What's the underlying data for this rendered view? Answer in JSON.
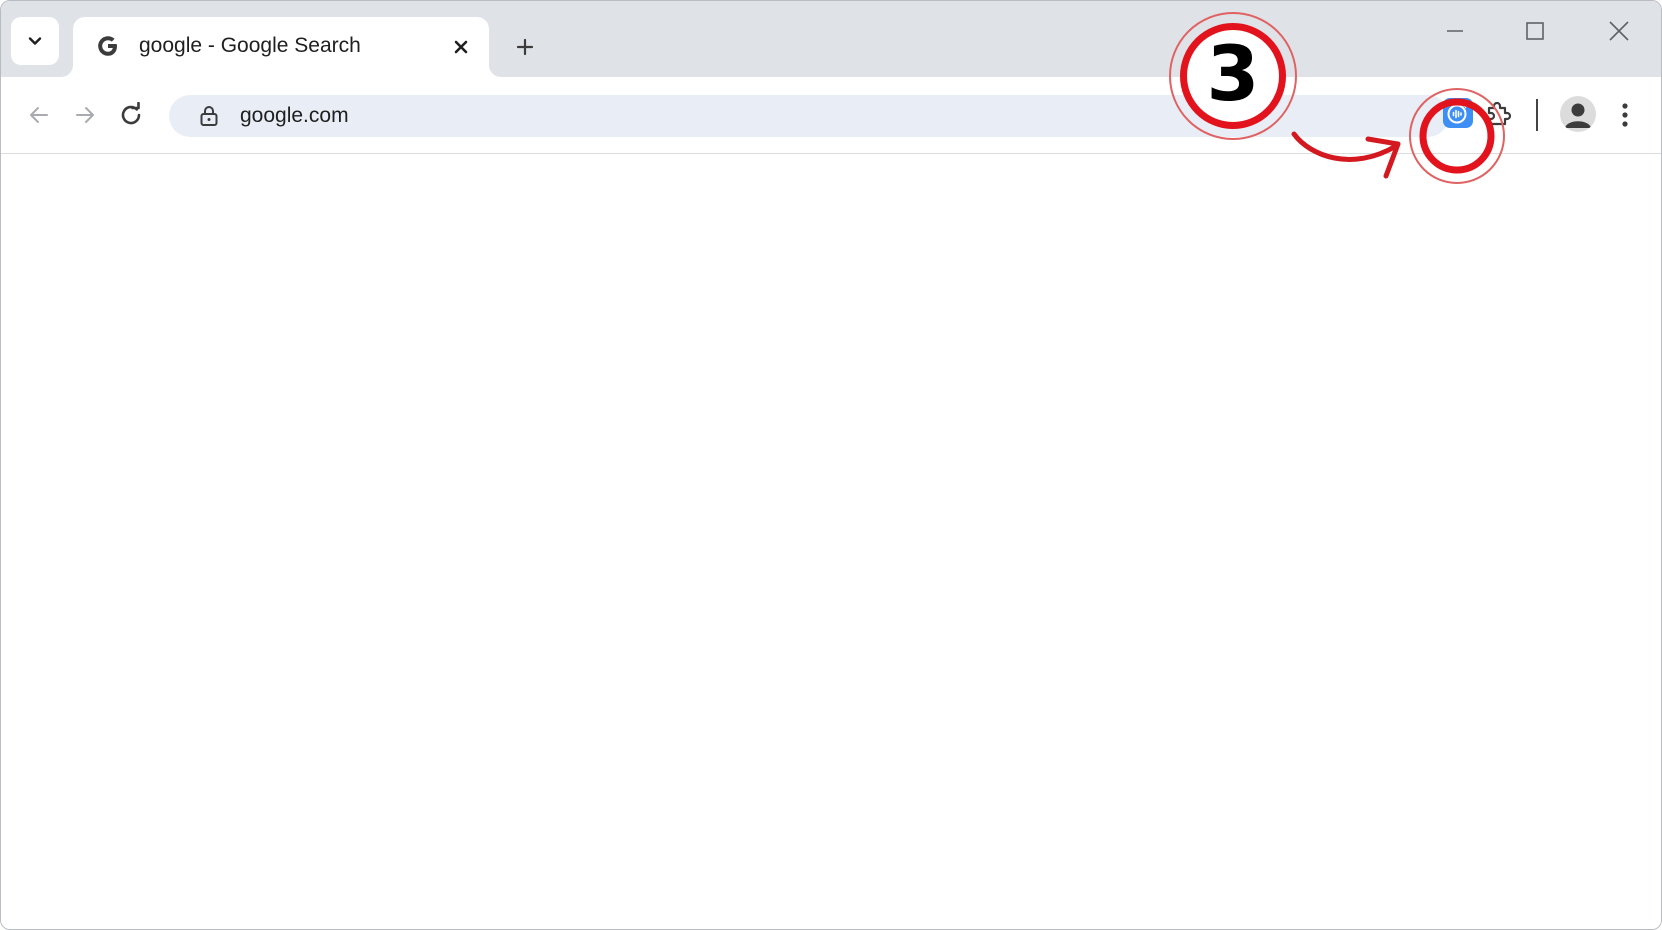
{
  "tab": {
    "title": "google - Google Search"
  },
  "new_tab_symbol": "+",
  "toolbar": {
    "url": "google.com"
  },
  "annotation": {
    "step_number": "3",
    "color": "#e2131c"
  },
  "icons": {
    "tab_search": "chevron-down-icon",
    "favicon": "google-g-icon",
    "tab_close": "close-icon",
    "new_tab": "plus-icon",
    "minimize": "minimize-icon",
    "maximize": "maximize-icon",
    "close_window": "close-icon",
    "back": "arrow-left-icon",
    "forward": "arrow-right-icon",
    "reload": "reload-icon",
    "lock": "lock-icon",
    "extension": "audio-wave-extension-icon",
    "extensions": "puzzle-icon",
    "profile": "person-icon",
    "menu": "kebab-menu-icon"
  },
  "colors": {
    "tabstrip": "#dfe2e7",
    "omnibox": "#e9eef6",
    "extension_bg": "#3d8ef5"
  }
}
